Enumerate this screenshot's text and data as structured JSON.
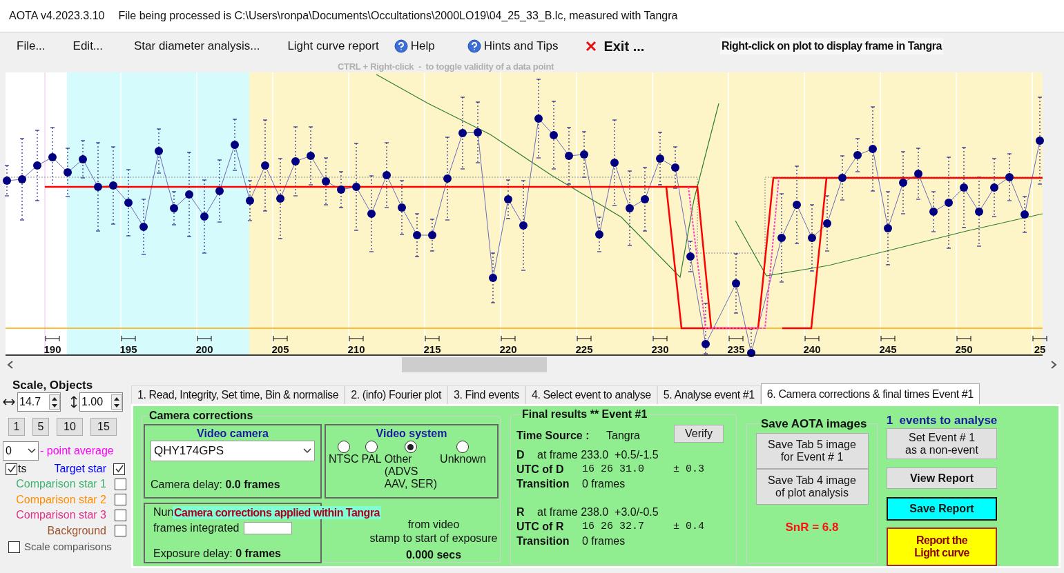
{
  "window": {
    "title": "AOTA v4.2023.3.10",
    "file_info": "File being processed is C:\\Users\\ronpa\\Documents\\Occultations\\2000LO19\\04_25_33_B.lc, measured with Tangra"
  },
  "menu": [
    {
      "label": "File...",
      "kind": "text"
    },
    {
      "label": "Edit...",
      "kind": "text"
    },
    {
      "label": "Star diameter analysis...",
      "kind": "text"
    },
    {
      "label": "Light curve report",
      "kind": "text"
    },
    {
      "label": "Help",
      "kind": "help"
    },
    {
      "label": "Hints and Tips",
      "kind": "help"
    },
    {
      "label": "Exit ...",
      "kind": "exit"
    }
  ],
  "plot_note": "Right-click on plot to display frame in Tangra",
  "plot_hint": "CTRL + Right-click  -  to toggle validity of a data point",
  "plot": {
    "x_axis_labels": [
      "190",
      "195",
      "200",
      "205",
      "210",
      "215",
      "220",
      "225",
      "230",
      "235",
      "240",
      "245",
      "250",
      "25"
    ]
  },
  "scale_objects": {
    "title": "Scale, Objects",
    "h_scale": "14.7",
    "v_scale": "1.00",
    "buttons": [
      "1",
      "5",
      "10",
      "15"
    ],
    "average_value": "0",
    "average_label": "- point average",
    "dots": {
      "label": "ts",
      "checked": true
    },
    "objects": [
      {
        "label": "Target star",
        "color": "#0000ff",
        "checked": true
      },
      {
        "label": "Comparison star 1",
        "color": "#3cb371",
        "checked": false
      },
      {
        "label": "Comparison star 2",
        "color": "#ff8c00",
        "checked": false
      },
      {
        "label": "Comparison star 3",
        "color": "#e0308a",
        "checked": false
      },
      {
        "label": "Background",
        "color": "#a0522d",
        "checked": false
      }
    ],
    "scale_comparisons": {
      "label": "Scale comparisons",
      "checked": false
    }
  },
  "tabs": [
    {
      "label": "1.  Read, Integrity, Set time, Bin & normalise",
      "selected": false
    },
    {
      "label": "2. (info)  Fourier plot",
      "selected": false
    },
    {
      "label": "3. Find events",
      "selected": false
    },
    {
      "label": "4. Select event to analyse",
      "selected": false
    },
    {
      "label": "5. Analyse event #1",
      "selected": false
    },
    {
      "label": "6. Camera corrections & final times Event #1",
      "selected": true
    }
  ],
  "camera_corrections": {
    "title": "Camera corrections",
    "video_camera": {
      "title": "Video camera",
      "value": "QHY174GPS"
    },
    "camera_delay": "Camera delay: **0.0 frames**",
    "video_system": {
      "title": "Video system",
      "options": [
        {
          "label": "NTSC",
          "selected": false
        },
        {
          "label": "PAL",
          "selected": false
        },
        {
          "label": "Other\n(ADVS\nAAV, SER)",
          "selected": true
        },
        {
          "label": "Unknown",
          "selected": false
        }
      ]
    },
    "frames_label_top": "Nun",
    "frames_label_bottom": "frames integrated",
    "banner": "Camera corrections applied within Tangra",
    "exposure_note": "from video\nstamp to start of exposure",
    "exposure_secs": "0.000 secs",
    "exposure_delay": "Exposure delay: **0 frames**"
  },
  "final_results": {
    "title": "Final results  **  Event #1",
    "verify": "Verify",
    "time_source_label": "Time Source :",
    "time_source": "Tangra",
    "events": [
      {
        "letter": "D",
        "frame": "at frame 233.0  +0.5/-1.5",
        "utc_label": "UTC of D",
        "utc": "16 26 31.0",
        "uncertainty": "± 0.3",
        "transition_label": "Transition",
        "transition": "0 frames"
      },
      {
        "letter": "R",
        "frame": "at frame 238.0  +3.0/-0.5",
        "utc_label": "UTC of R",
        "utc": "16 26 32.7",
        "uncertainty": "± 0.4",
        "transition_label": "Transition",
        "transition": "0 frames"
      }
    ]
  },
  "save_images": {
    "title": "Save AOTA images",
    "buttons": [
      "Save Tab 5 image\nfor Event # 1",
      "Save Tab 4 image\nof plot analysis"
    ],
    "snr": "SnR = 6.8"
  },
  "events_panel": {
    "count": "1  events to analyse",
    "buttons": [
      {
        "label": "Set Event # 1\nas a non-event",
        "kind": "plain"
      },
      {
        "label": "View Report",
        "kind": "bold"
      },
      {
        "label": "Save Report",
        "kind": "save"
      },
      {
        "label": "Report the\nLight curve",
        "kind": "report"
      }
    ]
  }
}
